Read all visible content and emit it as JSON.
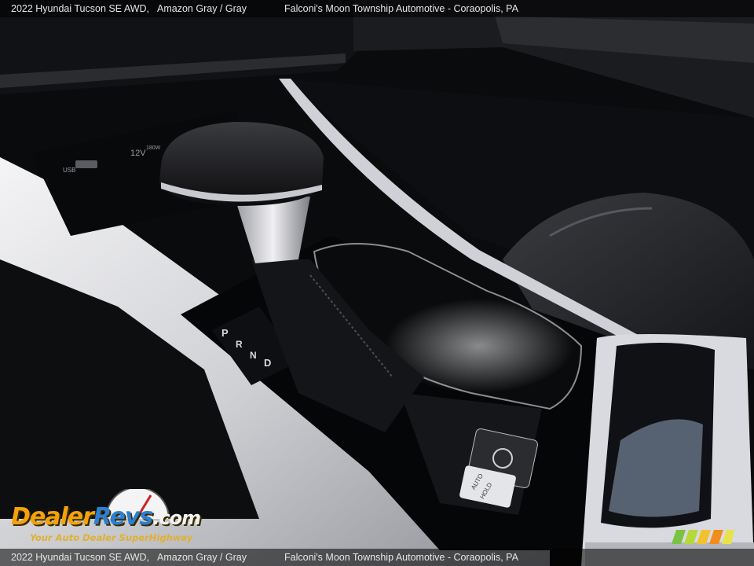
{
  "caption": {
    "vehicle": "2022 Hyundai Tucson SE AWD,",
    "color": "Amazon Gray / Gray",
    "dealer": "Falconi's Moon Township Automotive - Coraopolis, PA"
  },
  "photo_labels": {
    "usb": "USB",
    "power": "12V",
    "power_rating": "180W",
    "gear_p": "P",
    "gear_r": "R",
    "gear_n": "N",
    "gear_d": "D",
    "auto_hold_line1": "AUTO",
    "auto_hold_line2": "HOLD"
  },
  "watermark": {
    "brand_part1": "Dealer",
    "brand_part2": "Revs",
    "brand_part3": ".com",
    "tagline": "Your Auto Dealer SuperHighway"
  },
  "colors": {
    "brand_orange": "#f2a20c",
    "brand_blue": "#2d7fd0",
    "console_trim": "#d9dadd",
    "piano_black": "#050608"
  }
}
